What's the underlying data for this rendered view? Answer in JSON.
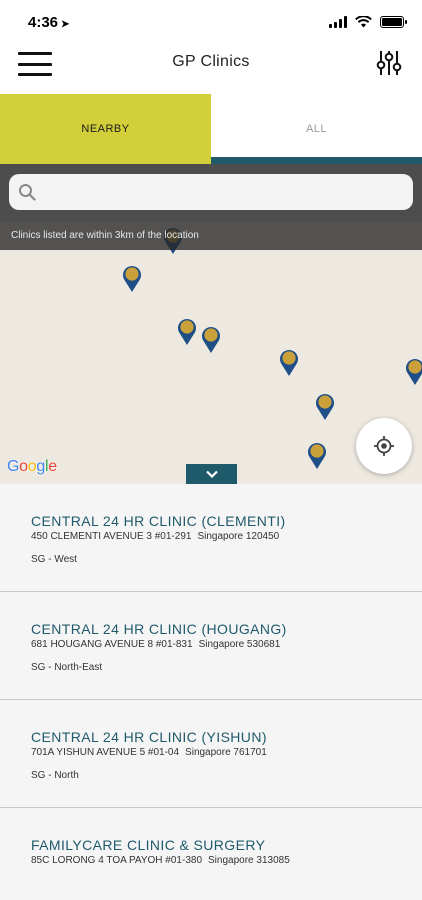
{
  "status_bar": {
    "time": "4:36"
  },
  "nav": {
    "title": "GP Clinics"
  },
  "tabs": [
    {
      "label": "NEARBY",
      "active": true
    },
    {
      "label": "ALL",
      "active": false
    }
  ],
  "search": {
    "placeholder": "",
    "value": ""
  },
  "map": {
    "note": "Clinics listed are within 3km of the location",
    "attribution": "Google",
    "pin_color": "#c9a03a",
    "pin_outline": "#1f4f86"
  },
  "clinics": [
    {
      "name": "CENTRAL 24 HR CLINIC (CLEMENTI)",
      "address": "450 CLEMENTI AVENUE 3 #01-291",
      "city": "Singapore 120450",
      "region": "SG - West"
    },
    {
      "name": "CENTRAL 24 HR CLINIC (HOUGANG)",
      "address": "681 HOUGANG AVENUE 8 #01-831",
      "city": "Singapore 530681",
      "region": "SG - North-East"
    },
    {
      "name": "CENTRAL 24 HR CLINIC (YISHUN)",
      "address": "701A YISHUN AVENUE 5 #01-04",
      "city": "Singapore 761701",
      "region": "SG - North"
    },
    {
      "name": "FAMILYCARE CLINIC & SURGERY",
      "address": "85C LORONG 4 TOA PAYOH #01-380",
      "city": "Singapore 313085",
      "region": ""
    }
  ],
  "colors": {
    "accent": "#d3cf3a",
    "teal": "#1f5a6b"
  }
}
